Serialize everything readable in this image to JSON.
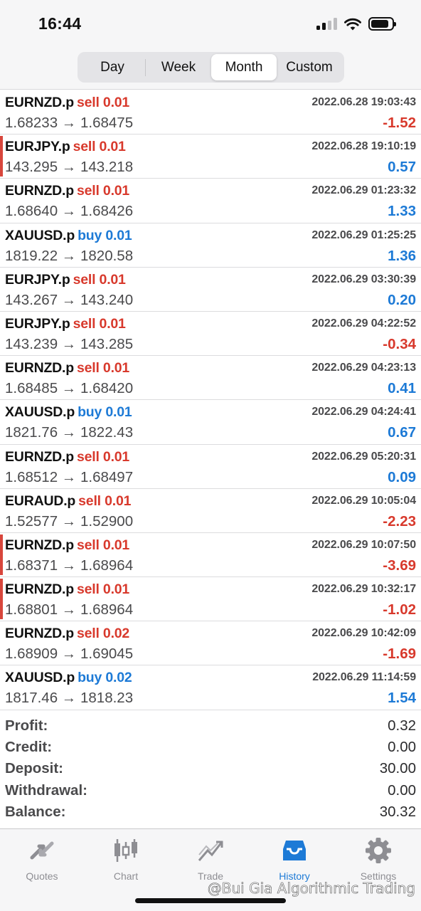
{
  "status": {
    "time": "16:44"
  },
  "segments": [
    {
      "label": "Day",
      "active": false
    },
    {
      "label": "Week",
      "active": false
    },
    {
      "label": "Month",
      "active": true
    },
    {
      "label": "Custom",
      "active": false
    }
  ],
  "trades": [
    {
      "symbol": "EURNZD.p",
      "side": "sell 0.01",
      "dir": "sell",
      "time": "2022.06.28 19:03:43",
      "prices": "1.68233 → 1.68475",
      "profit": "-1.52",
      "marked": false
    },
    {
      "symbol": "EURJPY.p",
      "side": "sell 0.01",
      "dir": "sell",
      "time": "2022.06.28 19:10:19",
      "prices": "143.295 → 143.218",
      "profit": "0.57",
      "marked": true
    },
    {
      "symbol": "EURNZD.p",
      "side": "sell 0.01",
      "dir": "sell",
      "time": "2022.06.29 01:23:32",
      "prices": "1.68640 → 1.68426",
      "profit": "1.33",
      "marked": false
    },
    {
      "symbol": "XAUUSD.p",
      "side": "buy 0.01",
      "dir": "buy",
      "time": "2022.06.29 01:25:25",
      "prices": "1819.22 → 1820.58",
      "profit": "1.36",
      "marked": false
    },
    {
      "symbol": "EURJPY.p",
      "side": "sell 0.01",
      "dir": "sell",
      "time": "2022.06.29 03:30:39",
      "prices": "143.267 → 143.240",
      "profit": "0.20",
      "marked": false
    },
    {
      "symbol": "EURJPY.p",
      "side": "sell 0.01",
      "dir": "sell",
      "time": "2022.06.29 04:22:52",
      "prices": "143.239 → 143.285",
      "profit": "-0.34",
      "marked": false
    },
    {
      "symbol": "EURNZD.p",
      "side": "sell 0.01",
      "dir": "sell",
      "time": "2022.06.29 04:23:13",
      "prices": "1.68485 → 1.68420",
      "profit": "0.41",
      "marked": false
    },
    {
      "symbol": "XAUUSD.p",
      "side": "buy 0.01",
      "dir": "buy",
      "time": "2022.06.29 04:24:41",
      "prices": "1821.76 → 1822.43",
      "profit": "0.67",
      "marked": false
    },
    {
      "symbol": "EURNZD.p",
      "side": "sell 0.01",
      "dir": "sell",
      "time": "2022.06.29 05:20:31",
      "prices": "1.68512 → 1.68497",
      "profit": "0.09",
      "marked": false
    },
    {
      "symbol": "EURAUD.p",
      "side": "sell 0.01",
      "dir": "sell",
      "time": "2022.06.29 10:05:04",
      "prices": "1.52577 → 1.52900",
      "profit": "-2.23",
      "marked": false
    },
    {
      "symbol": "EURNZD.p",
      "side": "sell 0.01",
      "dir": "sell",
      "time": "2022.06.29 10:07:50",
      "prices": "1.68371 → 1.68964",
      "profit": "-3.69",
      "marked": true
    },
    {
      "symbol": "EURNZD.p",
      "side": "sell 0.01",
      "dir": "sell",
      "time": "2022.06.29 10:32:17",
      "prices": "1.68801 → 1.68964",
      "profit": "-1.02",
      "marked": true
    },
    {
      "symbol": "EURNZD.p",
      "side": "sell 0.02",
      "dir": "sell",
      "time": "2022.06.29 10:42:09",
      "prices": "1.68909 → 1.69045",
      "profit": "-1.69",
      "marked": false
    },
    {
      "symbol": "XAUUSD.p",
      "side": "buy 0.02",
      "dir": "buy",
      "time": "2022.06.29 11:14:59",
      "prices": "1817.46 → 1818.23",
      "profit": "1.54",
      "marked": false
    }
  ],
  "summary": [
    {
      "label": "Profit:",
      "value": "0.32"
    },
    {
      "label": "Credit:",
      "value": "0.00"
    },
    {
      "label": "Deposit:",
      "value": "30.00"
    },
    {
      "label": "Withdrawal:",
      "value": "0.00"
    },
    {
      "label": "Balance:",
      "value": "30.32"
    }
  ],
  "tabs": [
    {
      "label": "Quotes",
      "icon": "quotes-icon",
      "active": false
    },
    {
      "label": "Chart",
      "icon": "chart-icon",
      "active": false
    },
    {
      "label": "Trade",
      "icon": "trade-icon",
      "active": false
    },
    {
      "label": "History",
      "icon": "history-icon",
      "active": true
    },
    {
      "label": "Settings",
      "icon": "settings-icon",
      "active": false
    }
  ],
  "watermark": "@Bui Gia Algorithmic Trading",
  "colors": {
    "sell": "#d8392c",
    "buy": "#1d7ad6",
    "accent": "#1d7ad6",
    "marker": "#d8463c"
  }
}
